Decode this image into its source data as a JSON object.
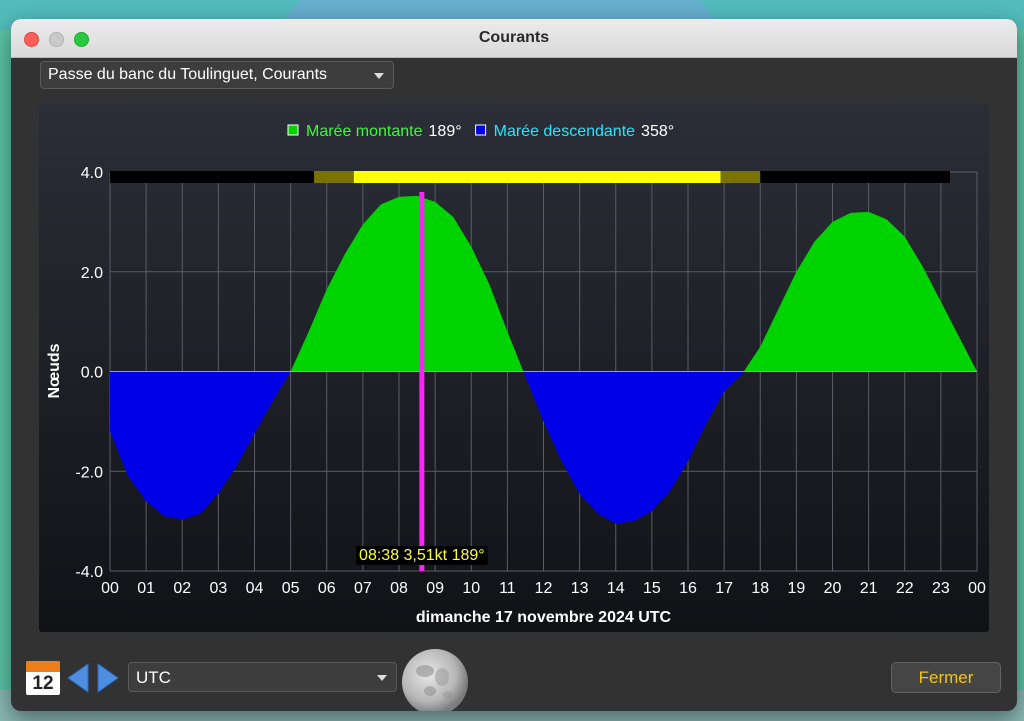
{
  "window": {
    "title": "Courants"
  },
  "station": {
    "selected": "Passe du banc du Toulinguet, Courants"
  },
  "legend": [
    {
      "name": "Marée montante",
      "value": "189°",
      "color": "#00d400",
      "label_color": "#33ff33"
    },
    {
      "name": "Marée descendante",
      "value": "358°",
      "color": "#0000e6",
      "label_color": "#22e6ff"
    }
  ],
  "cursor": {
    "label": "08:38 3,51kt 189°",
    "hour": 8.633,
    "color": "#ff22ff"
  },
  "chart_data": {
    "type": "area",
    "ylabel": "Nœuds",
    "xlabel": "dimanche 17 novembre 2024 UTC",
    "ylim": [
      -4.0,
      4.0
    ],
    "xlim": [
      0,
      24
    ],
    "y_ticks": [
      "4.0",
      "2.0",
      "0.0",
      "-2.0",
      "-4.0"
    ],
    "y_tick_values": [
      4,
      2,
      0,
      -2,
      -4
    ],
    "x_ticks": [
      "00",
      "01",
      "02",
      "03",
      "04",
      "05",
      "06",
      "07",
      "08",
      "09",
      "10",
      "11",
      "12",
      "13",
      "14",
      "15",
      "16",
      "17",
      "18",
      "19",
      "20",
      "21",
      "22",
      "23",
      "00"
    ],
    "grid": true,
    "series": {
      "x": [
        0,
        0.5,
        1,
        1.5,
        2,
        2.5,
        3,
        3.5,
        4,
        4.5,
        5,
        5.5,
        6,
        6.5,
        7,
        7.5,
        8,
        8.5,
        9,
        9.5,
        10,
        10.5,
        11,
        11.5,
        12,
        12.5,
        13,
        13.5,
        14,
        14.5,
        15,
        15.5,
        16,
        16.5,
        17,
        17.5,
        18,
        18.5,
        19,
        19.5,
        20,
        20.5,
        21,
        21.5,
        22,
        22.5,
        23,
        23.5,
        24
      ],
      "y": [
        -1.2,
        -2.1,
        -2.6,
        -2.9,
        -2.97,
        -2.85,
        -2.45,
        -1.9,
        -1.25,
        -0.6,
        0.0,
        0.8,
        1.65,
        2.35,
        2.95,
        3.35,
        3.5,
        3.52,
        3.4,
        3.1,
        2.5,
        1.75,
        0.8,
        -0.1,
        -1.0,
        -1.8,
        -2.45,
        -2.85,
        -3.05,
        -3.0,
        -2.8,
        -2.4,
        -1.8,
        -1.05,
        -0.4,
        -0.05,
        0.5,
        1.25,
        2.0,
        2.6,
        3.0,
        3.18,
        3.2,
        3.05,
        2.7,
        2.1,
        1.4,
        0.7,
        0.0
      ]
    },
    "daylight_bar": [
      {
        "from": 0.0,
        "to": 5.65,
        "color": "#000000"
      },
      {
        "from": 5.65,
        "to": 6.75,
        "color": "#7a7300"
      },
      {
        "from": 6.75,
        "to": 16.9,
        "color": "#ffff00"
      },
      {
        "from": 16.9,
        "to": 18.0,
        "color": "#7a7300"
      },
      {
        "from": 18.0,
        "to": 23.25,
        "color": "#000000"
      }
    ]
  },
  "footer": {
    "calendar_day": "12",
    "timezone": "UTC",
    "close_label": "Fermer"
  }
}
